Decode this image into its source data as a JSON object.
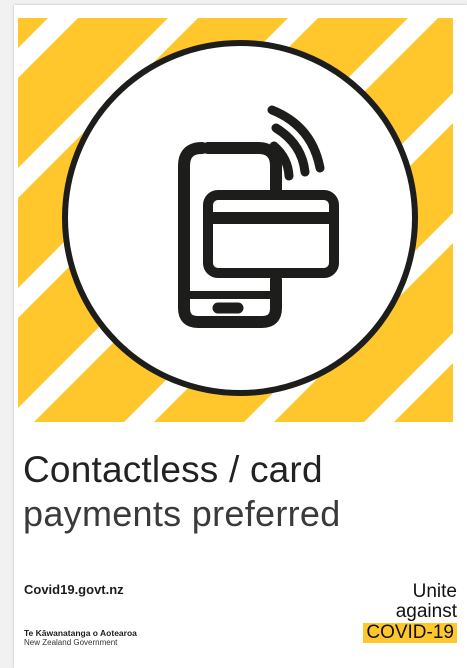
{
  "hero": {
    "icon": "contactless-phone-card-icon",
    "stripe_color": "#ffc72c",
    "line_color": "#1d1d1b"
  },
  "headline": {
    "line1": "Contactless / card",
    "line2": "payments preferred"
  },
  "footer": {
    "website": "Covid19.govt.nz",
    "gov_maori": "Te Kāwanatanga o Aotearoa",
    "gov_english": "New Zealand Government",
    "brand_line1": "Unite",
    "brand_line2": "against",
    "brand_tag": "COVID-19",
    "brand_tag_color": "#ffc72c"
  }
}
